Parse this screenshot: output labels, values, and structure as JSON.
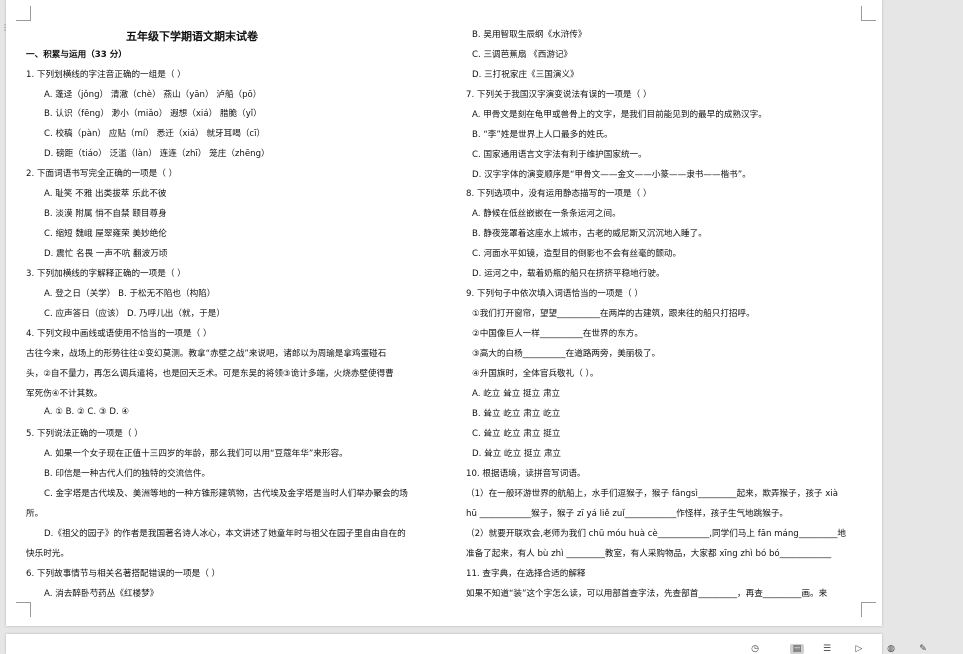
{
  "document": {
    "title": "五年级下学期语文期末试卷",
    "left_column": [
      "一、积累与运用（33 分）",
      "1.  下列划横线的字注音正确的一组是（      ）",
      "A.  蓬迳（jǒng）        清澈（chè）         燕山（yān）         泸船（pō）",
      "B.  认识（fēng）       渺小（miǎo）        遐想（xiá）          腊脆（yǐ）",
      "C.  校稿（pàn）        应贴（mí）          悉迁（xiá）          就牙耳喝（cī）",
      "D.  磅距（tiáo）       泛滥（làn）         连连（zhī）          笼庄（zhēng）",
      "2.  下面词语书写完全正确的一项是（      ）",
      "A.  耻笑        不雅        出类拔萃        乐此不彼",
      "B.  淡漠        附属        悄不自禁        颐目尊身",
      "C.  缩短        魏峨        屋翠雍荣        美妙绝伦",
      "D.  震忙        名畏        一声不吭        翻波万顷",
      "3.  下列加横线的字解释正确的一项是（      ）",
      "A.  登之日（关学）                                     B.  于松无不陷也（构陷）",
      "C.  应声答日（应该）                                   D.  乃呼儿出（就，于是）",
      "4.  下列文段中画线或语使用不恰当的一项是（      ）",
      "    古往今来，战场上的形势往往①变幻莫测。教拿“赤壁之战”来说吧，诸郎以为周瑜是拿鸡蛋碰石",
      "头，②自不量力，再怎么调兵遣将，也是回天乏术。可是东吴的将领③诡计多端，火烧赤壁使得曹",
      "军死伤④不计其数。",
      "A.  ①                    B.  ②                    C.  ③                    D.  ④",
      "5.  下列说法正确的一项是（      ）",
      "A.  如果一个女子现在正值十三四岁的年龄，那么我们可以用“豆蔻年华”来形容。",
      "B.  印信是一种古代人们的独特的交流信件。",
      "C.  金字塔是古代埃及、美洲等地的一种方锥形建筑物，古代埃及金字塔是当时人们举办聚会的场",
      "所。",
      "D.《祖父的园子》的作者是我国著名诗人冰心，本文讲述了她童年时与祖父在园子里自由自在的",
      "快乐时光。",
      "6.  下列故事情节与相关名著搭配错误的一项是（      ）",
      "A.  消去醉卧芍药丛《红楼梦》"
    ],
    "right_column": [
      "B.  吴用智取生辰纲《水浒传》",
      "C.  三调芭蕉扇  《西游记》",
      "D.  三打祝家庄《三国演义》",
      "7.  下列关于我国汉字演变说法有误的一项是（      ）",
      "A.  甲骨文是刻在龟甲或兽骨上的文字，是我们目前能见到的最早的成熟汉字。",
      "B.  “李”姓是世界上人口最多的姓氏。",
      "C.  国家通用语言文字法有利于维护国家统一。",
      "D.  汉字字体的演变顺序是“甲骨文——金文——小篆——隶书——楷书”。",
      "8.  下列选项中，没有运用静态描写的一项是（      ）",
      "A.  静候在低丝嵌嵌在一条条运河之间。",
      "B.  静夜笼罩着这座水上城市，古老的威尼斯又沉沉地入睡了。",
      "C.  河面水平如镜，造型目的倒影也不会有丝毫的颤动。",
      "D.  运河之中，载着奶瓶的船只在挤挤平稳地行驶。",
      "9.  下列句子中依次填入词语恰当的一项是（      ）",
      "①我们打开窗帘，望望__________在两岸的古建筑，跟来往的船只打招呼。",
      "②中国像巨人一样__________在世界的东方。",
      "③高大的白杨__________在道路两旁，美丽极了。",
      "④升国旗时，全体官兵敬礼（      ）。",
      "A.  屹立        耸立        挺立        肃立",
      "B.  耸立        屹立        肃立        屹立",
      "C.  耸立        屹立        肃立        挺立",
      "D.  耸立        屹立        挺立        肃立",
      "10.  根据语境，读拼音写词语。",
      "    （1）在一般环游世界的航船上，水手们逗猴子，猴子 fāngsì_________起来，欺弄猴子，孩子 xià",
      "hū ____________猴子，猴子 zī yá liě zuǐ____________作怪样，孩子生气地跳猴子。",
      "    （2）就要开联欢会,老师为我们 chū móu huà cè____________,同学们马上 fān máng_________地",
      "准备了起来，有人 bù zhì _________教室，有人采购物品，大家都 xīng zhì bó bó____________",
      "11.  查字典，在选择合适的解释",
      "    如果不知道“装”这个字怎么读，可以用部首查字法，先查部首_________，再查_________画。来"
    ]
  },
  "status_bar": {
    "icons": [
      "web-layout-icon",
      "print-layout-icon",
      "outline-icon",
      "read-mode-icon",
      "globe-icon",
      "pen-icon"
    ]
  }
}
